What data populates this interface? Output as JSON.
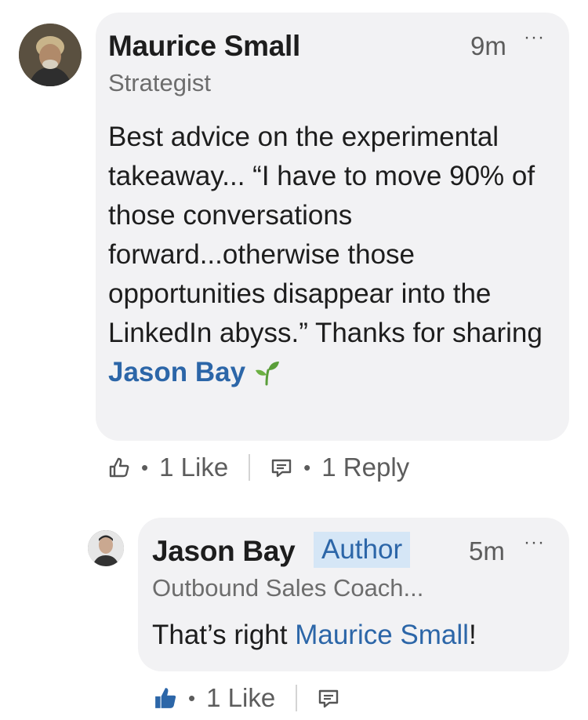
{
  "comment": {
    "author": "Maurice Small",
    "headline": "Strategist",
    "time": "9m",
    "more": "···",
    "body_text": "Best advice on the experimental takeaway...  “I have to move 90% of those conversations forward...otherwise those opportunities disappear into the LinkedIn abyss.” Thanks for sharing ",
    "mention": "Jason Bay",
    "like_count": "1 Like",
    "reply_count": "1 Reply",
    "separator": "•"
  },
  "reply": {
    "author": "Jason Bay",
    "badge": "Author",
    "headline": "Outbound Sales Coach...",
    "time": "5m",
    "more": "···",
    "body_prefix": "That’s right ",
    "mention": "Maurice Small",
    "body_suffix": "!",
    "like_count": "1 Like",
    "separator": "•"
  },
  "colors": {
    "bubble_bg": "#f2f2f4",
    "mention_link": "#2c66a8",
    "author_badge_bg": "#d5e6f6",
    "liked_thumb": "#2c66a8",
    "sprout": "#5a9e3a"
  },
  "icons": {
    "like_outline": "thumbs-up-outline-icon",
    "like_filled": "thumbs-up-filled-icon",
    "reply": "comment-icon",
    "emoji": "seedling-emoji-icon"
  }
}
